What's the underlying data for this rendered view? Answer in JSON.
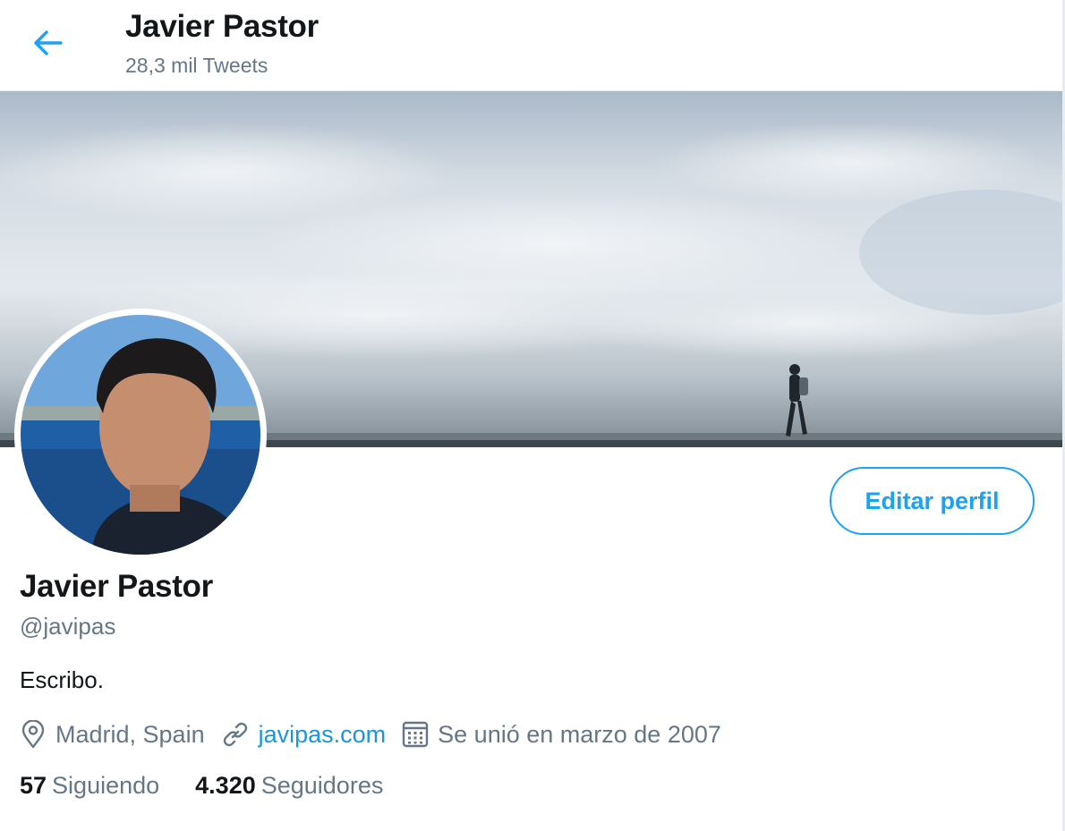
{
  "header": {
    "title": "Javier Pastor",
    "tweet_count": "28,3 mil Tweets"
  },
  "profile": {
    "name": "Javier Pastor",
    "handle": "@javipas",
    "bio": "Escribo.",
    "edit_button": "Editar perfil",
    "location": "Madrid, Spain",
    "website": "javipas.com",
    "joined": "Se unió en marzo de 2007"
  },
  "stats": {
    "following_count": "57",
    "following_label": "Siguiendo",
    "followers_count": "4.320",
    "followers_label": "Seguidores"
  },
  "colors": {
    "accent": "#1da1f2",
    "secondary_text": "#657786",
    "primary_text": "#14171a"
  },
  "icons": {
    "back": "arrow-left-icon",
    "location": "location-pin-icon",
    "website": "link-icon",
    "joined": "calendar-icon"
  }
}
